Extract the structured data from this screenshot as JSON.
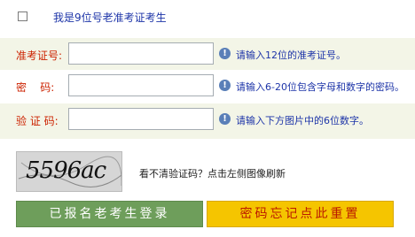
{
  "checkbox": {
    "label": "我是9位号老准考证考生",
    "checked": false
  },
  "fields": [
    {
      "label": "准考证号:",
      "value": "",
      "hint": "请输入12位的准考证号。"
    },
    {
      "label": "密    码:",
      "value": "",
      "hint": "请输入6-20位包含字母和数字的密码。"
    },
    {
      "label": "验 证 码:",
      "value": "",
      "hint": "请输入下方图片中的6位数字。"
    }
  ],
  "captcha": {
    "text": "5596ac",
    "refresh_hint": "看不清验证码？点击左侧图像刷新"
  },
  "buttons": {
    "login": "已报名老考生登录",
    "reset": "密码忘记点此重置"
  },
  "colors": {
    "label_red": "#cc2200",
    "hint_blue": "#1d34a8",
    "login_green": "#6e9e5b",
    "reset_yellow": "#f5c500"
  }
}
